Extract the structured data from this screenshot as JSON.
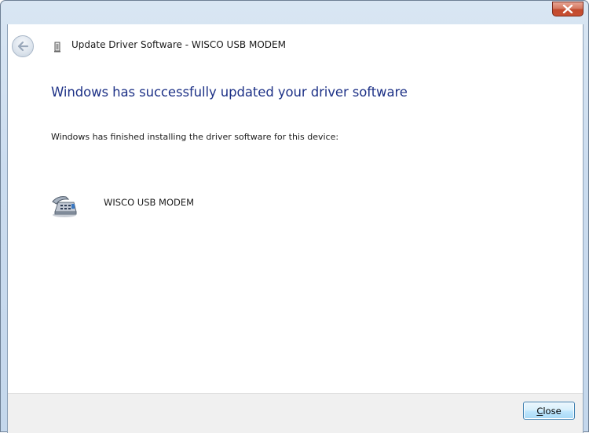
{
  "window": {
    "title": "Update Driver Software - WISCO USB MODEM",
    "close_label": "×"
  },
  "content": {
    "headline": "Windows has successfully updated your driver software",
    "description": "Windows has finished installing the driver software for this device:",
    "device": {
      "name": "WISCO USB MODEM",
      "icon": "modem-phone-icon"
    }
  },
  "footer": {
    "close_button": {
      "mnemonic": "C",
      "rest": "lose"
    }
  },
  "colors": {
    "headline": "#1e3287",
    "close_caption": "#c84f32",
    "button_border": "#3c7fb1"
  }
}
